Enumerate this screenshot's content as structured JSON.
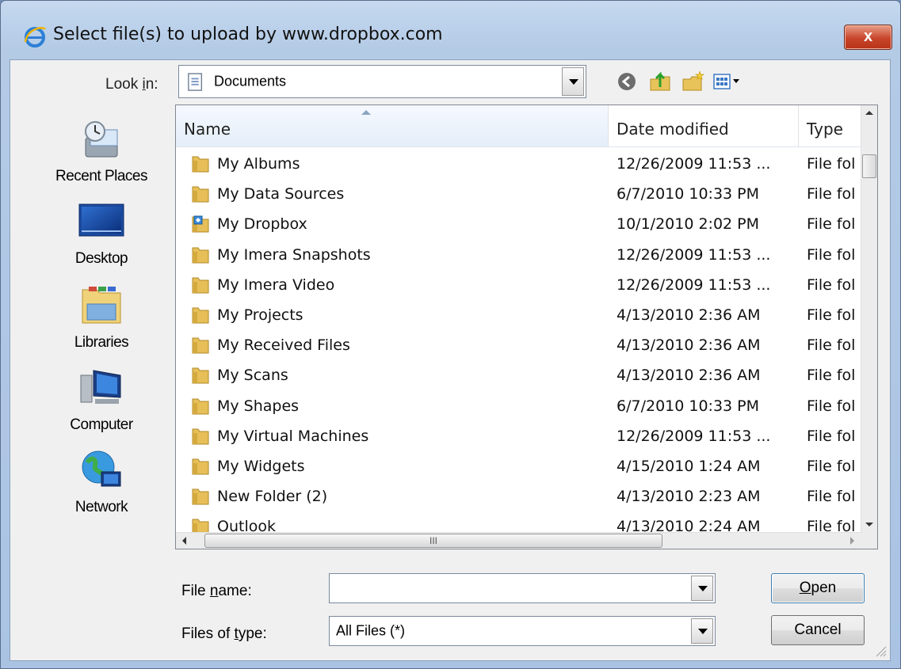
{
  "window": {
    "title": "Select file(s) to upload by www.dropbox.com",
    "close_label": "x"
  },
  "lookin": {
    "label_pre": "Look ",
    "label_u": "i",
    "label_post": "n:",
    "value": "Documents"
  },
  "toolbar": {
    "icons": [
      "back-icon",
      "up-folder-icon",
      "new-folder-icon",
      "views-menu-icon"
    ]
  },
  "places": [
    {
      "label": "Recent Places",
      "icon": "recent-places-icon"
    },
    {
      "label": "Desktop",
      "icon": "desktop-icon"
    },
    {
      "label": "Libraries",
      "icon": "libraries-icon"
    },
    {
      "label": "Computer",
      "icon": "computer-icon"
    },
    {
      "label": "Network",
      "icon": "network-icon"
    }
  ],
  "filelist": {
    "columns": [
      "Name",
      "Date modified",
      "Type"
    ],
    "sorted_column": "Name",
    "rows": [
      {
        "name": "My Albums",
        "date": "12/26/2009 11:53 ...",
        "type": "File fol",
        "icon": "folder"
      },
      {
        "name": "My Data Sources",
        "date": "6/7/2010 10:33 PM",
        "type": "File fol",
        "icon": "folder"
      },
      {
        "name": "My Dropbox",
        "date": "10/1/2010 2:02 PM",
        "type": "File fol",
        "icon": "dropbox-folder"
      },
      {
        "name": "My Imera Snapshots",
        "date": "12/26/2009 11:53 ...",
        "type": "File fol",
        "icon": "folder"
      },
      {
        "name": "My Imera Video",
        "date": "12/26/2009 11:53 ...",
        "type": "File fol",
        "icon": "folder"
      },
      {
        "name": "My Projects",
        "date": "4/13/2010 2:36 AM",
        "type": "File fol",
        "icon": "folder"
      },
      {
        "name": "My Received Files",
        "date": "4/13/2010 2:36 AM",
        "type": "File fol",
        "icon": "folder"
      },
      {
        "name": "My Scans",
        "date": "4/13/2010 2:36 AM",
        "type": "File fol",
        "icon": "folder"
      },
      {
        "name": "My Shapes",
        "date": "6/7/2010 10:33 PM",
        "type": "File fol",
        "icon": "folder"
      },
      {
        "name": "My Virtual Machines",
        "date": "12/26/2009 11:53 ...",
        "type": "File fol",
        "icon": "folder"
      },
      {
        "name": "My Widgets",
        "date": "4/15/2010 1:24 AM",
        "type": "File fol",
        "icon": "folder"
      },
      {
        "name": "New Folder (2)",
        "date": "4/13/2010 2:23 AM",
        "type": "File fol",
        "icon": "folder"
      },
      {
        "name": "Outlook",
        "date": "4/13/2010 2:24 AM",
        "type": "File fol",
        "icon": "folder"
      }
    ],
    "hscroll_grip": "III"
  },
  "filename": {
    "label_pre": "File ",
    "label_u": "n",
    "label_post": "ame:",
    "value": ""
  },
  "filetype": {
    "label_pre": "Files of ",
    "label_u": "t",
    "label_post": "ype:",
    "value": "All Files (*)"
  },
  "buttons": {
    "open_u": "O",
    "open_rest": "pen",
    "cancel": "Cancel"
  },
  "colors": {
    "frame": "#b4cbe6",
    "client": "#f0f0f0",
    "close": "#c8452a",
    "folder": "#e8c35a"
  }
}
